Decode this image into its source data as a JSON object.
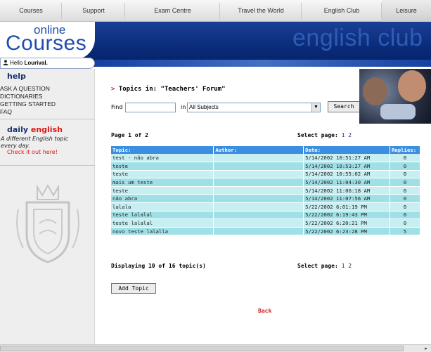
{
  "nav": {
    "tabs": [
      "Courses",
      "Support",
      "Exam Centre",
      "Travel the World",
      "English Club",
      "Leisure"
    ]
  },
  "header": {
    "logo_online": "online",
    "logo_courses": "Courses",
    "brand": "english club"
  },
  "hello": {
    "prefix": "Hello",
    "user": "Lourival."
  },
  "sidebar": {
    "help_title": "help",
    "help_links": [
      "ASK A QUESTION",
      "DICTIONARIES",
      "GETTING STARTED",
      "FAQ"
    ],
    "daily_title_1": "daily",
    "daily_title_2": "english",
    "daily_text_1": "A different English topic",
    "daily_text_2": "every day.",
    "daily_link": "Check it out here!"
  },
  "main": {
    "heading_arrow": ">",
    "heading": "Topics in: \"Teachers' Forum\"",
    "find_label": "Find",
    "find_value": "",
    "in_label": "in",
    "subject_selected": "All Subjects",
    "search_label": "Search",
    "page_of": "Page 1 of 2",
    "select_page_label": "Select page:",
    "pages": [
      "1",
      "2"
    ],
    "displaying": "Displaying 10 of 16 topic(s)",
    "add_topic_label": "Add Topic",
    "back_label": "Back"
  },
  "table": {
    "headers": [
      "Topic:",
      "Author:",
      "Date:",
      "Replies:"
    ],
    "rows": [
      {
        "topic": "test - não abra",
        "author": "",
        "date": "5/14/2002 10:51:27 AM",
        "replies": "0"
      },
      {
        "topic": "teste",
        "author": "",
        "date": "5/14/2002 10:53:27 AM",
        "replies": "0"
      },
      {
        "topic": "teste",
        "author": "",
        "date": "5/14/2002 10:55:02 AM",
        "replies": "0"
      },
      {
        "topic": "mais um teste",
        "author": "",
        "date": "5/14/2002 11:04:30 AM",
        "replies": "0"
      },
      {
        "topic": "teste",
        "author": "",
        "date": "5/14/2002 11:06:18 AM",
        "replies": "0"
      },
      {
        "topic": "não abra",
        "author": "",
        "date": "5/14/2002 11:07:56 AM",
        "replies": "0"
      },
      {
        "topic": "lalala",
        "author": "",
        "date": "5/22/2002 6:01:19 PM",
        "replies": "0"
      },
      {
        "topic": "teste lalalal",
        "author": "",
        "date": "5/22/2002 6:19:43 PM",
        "replies": "0"
      },
      {
        "topic": "teste lalalal",
        "author": "",
        "date": "5/22/2002 6:20:21 PM",
        "replies": "0"
      },
      {
        "topic": "novo teste lalalla",
        "author": "",
        "date": "5/22/2002 6:23:28 PM",
        "replies": "5"
      }
    ]
  },
  "colors": {
    "header_blue": "#0a2a78",
    "table_header": "#3c8ee0",
    "row_light": "#c7eef1",
    "row_dark": "#9fe0e6",
    "accent_red": "#e01616"
  },
  "icons": {
    "user": "user-icon",
    "dropdown": "chevron-down-icon",
    "scroll_right": "arrow-right-icon"
  }
}
